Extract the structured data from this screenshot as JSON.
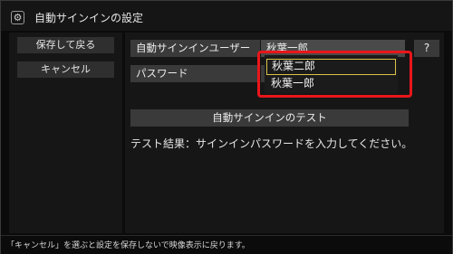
{
  "window": {
    "title": "自動サインインの設定",
    "icon": "gear-icon"
  },
  "sidebar": {
    "save_label": "保存して戻る",
    "cancel_label": "キャンセル"
  },
  "form": {
    "user_label": "自動サインインユーザー",
    "user_value": "秋葉一郎",
    "password_label": "パスワード",
    "help_label": "?",
    "test_button_label": "自動サインインのテスト",
    "test_result": "テスト結果：サインインパスワードを入力してください。"
  },
  "dropdown": {
    "options": [
      {
        "label": "秋葉二郎",
        "focused": true
      },
      {
        "label": "秋葉一郎",
        "focused": false
      }
    ]
  },
  "status_bar": {
    "text": "「キャンセル」を選ぶと設定を保存しないで映像表示に戻ります。"
  },
  "colors": {
    "highlight_frame": "#e8161b",
    "focus_border": "#d9c34a",
    "button_bg": "#3a3a3a",
    "panel_bg": "#161616"
  }
}
